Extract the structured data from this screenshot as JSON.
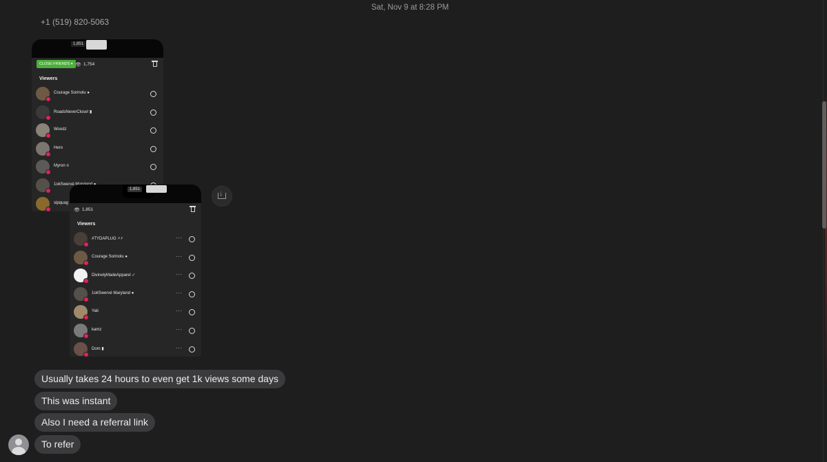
{
  "timestamp": "Sat, Nov 9 at 8:28 PM",
  "sender": "+1 (519) 820-5063",
  "screenshot_1": {
    "mini_count": "1,851",
    "badge": "CLOSE FRIENDS ▾",
    "view_count": "1,754",
    "viewers_title": "Viewers",
    "viewers": [
      {
        "name": "Courage Sorinolu ●",
        "color": "#6e5a44"
      },
      {
        "name": "RoadsNeverClose! ▮",
        "color": "#3a3a3a"
      },
      {
        "name": "Woodz",
        "color": "#8a8378"
      },
      {
        "name": "Hero",
        "color": "#7d7570"
      },
      {
        "name": "Myron ≡",
        "color": "#5c5a58"
      },
      {
        "name": "1okSwervé   Maryland ●",
        "color": "#55504a"
      },
      {
        "name": "sipquag",
        "color": "#8a6a2c"
      }
    ]
  },
  "screenshot_2": {
    "mini_count": "1,851",
    "view_count": "1,851",
    "viewers_title": "Viewers",
    "viewers": [
      {
        "name": "#TYDAPLUG ⚡⚡",
        "color": "#4a3f36"
      },
      {
        "name": "Courage Sorinolu ●",
        "color": "#6e5a44"
      },
      {
        "name": "DivinelyMadeApparel ✓",
        "color": "#f2f2f2"
      },
      {
        "name": "1okSwervé   Maryland ●",
        "color": "#55504a"
      },
      {
        "name": "Yati",
        "color": "#a08a6a"
      },
      {
        "name": "kamz",
        "color": "#7a7a7a"
      },
      {
        "name": "Dom ▮",
        "color": "#6a5048"
      }
    ]
  },
  "messages": [
    "Usually takes 24 hours to even get 1k views some days",
    "This was instant",
    "Also I need a referral link",
    "To refer"
  ]
}
